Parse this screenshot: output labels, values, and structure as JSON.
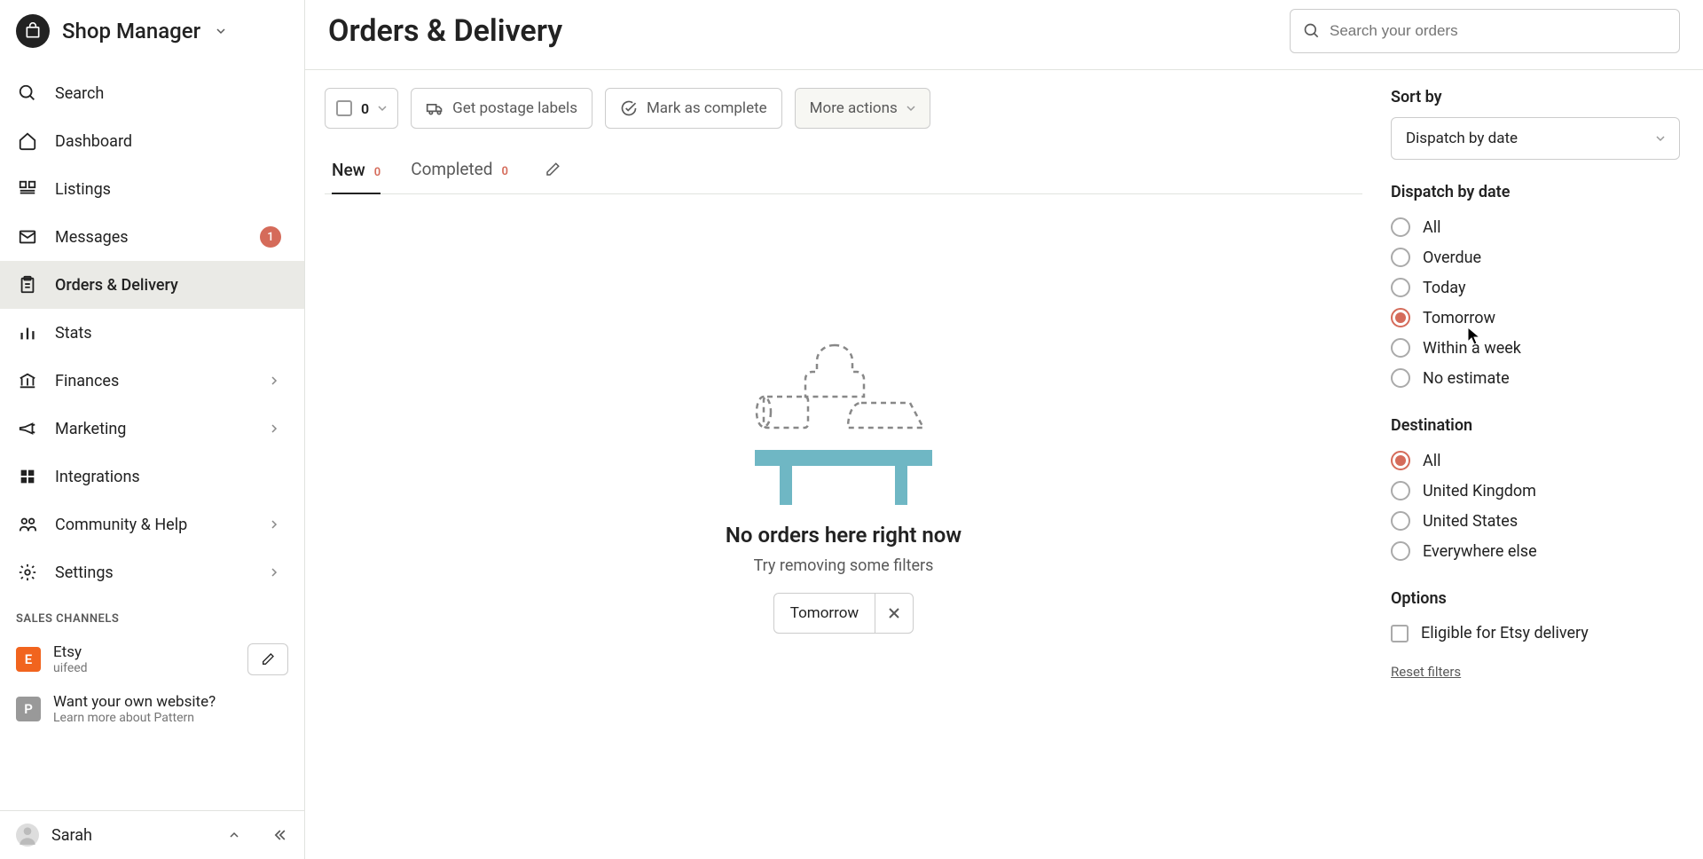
{
  "header": {
    "shop_title": "Shop Manager"
  },
  "sidebar": {
    "search": "Search",
    "dashboard": "Dashboard",
    "listings": "Listings",
    "messages": "Messages",
    "messages_badge": "1",
    "orders": "Orders & Delivery",
    "stats": "Stats",
    "finances": "Finances",
    "marketing": "Marketing",
    "integrations": "Integrations",
    "community": "Community & Help",
    "settings": "Settings",
    "channels_header": "SALES CHANNELS",
    "channel1_name": "Etsy",
    "channel1_sub": "uifeed",
    "channel2_name": "Want your own website?",
    "channel2_sub": "Learn more about Pattern",
    "user": "Sarah"
  },
  "page": {
    "title": "Orders & Delivery",
    "search_placeholder": "Search your orders"
  },
  "toolbar": {
    "selected_count": "0",
    "postage": "Get postage labels",
    "complete": "Mark as complete",
    "more": "More actions"
  },
  "tabs": {
    "new": "New",
    "new_count": "0",
    "completed": "Completed",
    "completed_count": "0"
  },
  "empty": {
    "title": "No orders here right now",
    "sub": "Try removing some filters",
    "chip": "Tomorrow"
  },
  "filters": {
    "sort_label": "Sort by",
    "sort_value": "Dispatch by date",
    "dispatch_label": "Dispatch by date",
    "dispatch_all": "All",
    "dispatch_overdue": "Overdue",
    "dispatch_today": "Today",
    "dispatch_tomorrow": "Tomorrow",
    "dispatch_week": "Within a week",
    "dispatch_none": "No estimate",
    "dest_label": "Destination",
    "dest_all": "All",
    "dest_uk": "United Kingdom",
    "dest_us": "United States",
    "dest_else": "Everywhere else",
    "options_label": "Options",
    "eligible": "Eligible for Etsy delivery",
    "reset": "Reset filters"
  }
}
